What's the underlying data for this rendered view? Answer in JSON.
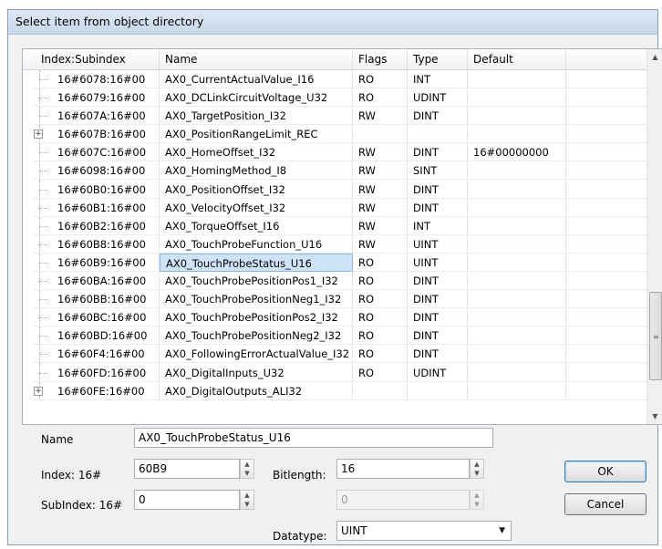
{
  "dialog": {
    "title": "Select item from object directory"
  },
  "table": {
    "columns": [
      "Index:Subindex",
      "Name",
      "Flags",
      "Type",
      "Default"
    ],
    "rows": [
      {
        "index": "16#6078:16#00",
        "name": "AX0_CurrentActualValue_I16",
        "flags": "RO",
        "type": "INT",
        "default": "",
        "expander": ""
      },
      {
        "index": "16#6079:16#00",
        "name": "AX0_DCLinkCircuitVoltage_U32",
        "flags": "RO",
        "type": "UDINT",
        "default": "",
        "expander": ""
      },
      {
        "index": "16#607A:16#00",
        "name": "AX0_TargetPosition_I32",
        "flags": "RW",
        "type": "DINT",
        "default": "",
        "expander": ""
      },
      {
        "index": "16#607B:16#00",
        "name": "AX0_PositionRangeLimit_REC",
        "flags": "",
        "type": "",
        "default": "",
        "expander": "+"
      },
      {
        "index": "16#607C:16#00",
        "name": "AX0_HomeOffset_I32",
        "flags": "RW",
        "type": "DINT",
        "default": "16#00000000",
        "expander": ""
      },
      {
        "index": "16#6098:16#00",
        "name": "AX0_HomingMethod_I8",
        "flags": "RW",
        "type": "SINT",
        "default": "",
        "expander": ""
      },
      {
        "index": "16#60B0:16#00",
        "name": "AX0_PositionOffset_I32",
        "flags": "RW",
        "type": "DINT",
        "default": "",
        "expander": ""
      },
      {
        "index": "16#60B1:16#00",
        "name": "AX0_VelocityOffset_I32",
        "flags": "RW",
        "type": "DINT",
        "default": "",
        "expander": ""
      },
      {
        "index": "16#60B2:16#00",
        "name": "AX0_TorqueOffset_I16",
        "flags": "RW",
        "type": "INT",
        "default": "",
        "expander": ""
      },
      {
        "index": "16#60B8:16#00",
        "name": "AX0_TouchProbeFunction_U16",
        "flags": "RW",
        "type": "UINT",
        "default": "",
        "expander": ""
      },
      {
        "index": "16#60B9:16#00",
        "name": "AX0_TouchProbeStatus_U16",
        "flags": "RO",
        "type": "UINT",
        "default": "",
        "expander": "",
        "selected": true
      },
      {
        "index": "16#60BA:16#00",
        "name": "AX0_TouchProbePositionPos1_I32",
        "flags": "RO",
        "type": "DINT",
        "default": "",
        "expander": ""
      },
      {
        "index": "16#60BB:16#00",
        "name": "AX0_TouchProbePositionNeg1_I32",
        "flags": "RO",
        "type": "DINT",
        "default": "",
        "expander": ""
      },
      {
        "index": "16#60BC:16#00",
        "name": "AX0_TouchProbePositionPos2_I32",
        "flags": "RO",
        "type": "DINT",
        "default": "",
        "expander": ""
      },
      {
        "index": "16#60BD:16#00",
        "name": "AX0_TouchProbePositionNeg2_I32",
        "flags": "RO",
        "type": "DINT",
        "default": "",
        "expander": ""
      },
      {
        "index": "16#60F4:16#00",
        "name": "AX0_FollowingErrorActualValue_I32",
        "flags": "RO",
        "type": "DINT",
        "default": "",
        "expander": ""
      },
      {
        "index": "16#60FD:16#00",
        "name": "AX0_DigitalInputs_U32",
        "flags": "RO",
        "type": "UDINT",
        "default": "",
        "expander": ""
      },
      {
        "index": "16#60FE:16#00",
        "name": "AX0_DigitalOutputs_ALI32",
        "flags": "",
        "type": "",
        "default": "",
        "expander": "+"
      }
    ]
  },
  "form": {
    "name_label": "Name",
    "name_value": "AX0_TouchProbeStatus_U16",
    "index_label": "Index: 16#",
    "index_value": "60B9",
    "bitlength_label": "Bitlength:",
    "bitlength_value": "16",
    "subindex_label": "SubIndex: 16#",
    "subindex_value": "0",
    "bitoffset_value": "0",
    "datatype_label": "Datatype:",
    "datatype_value": "UINT"
  },
  "buttons": {
    "ok": "OK",
    "cancel": "Cancel"
  },
  "icons": {
    "scroll_up": "▲",
    "scroll_down": "▼",
    "grip": "≡",
    "dropdown": "▼",
    "spin_up": "▲",
    "spin_down": "▼"
  }
}
